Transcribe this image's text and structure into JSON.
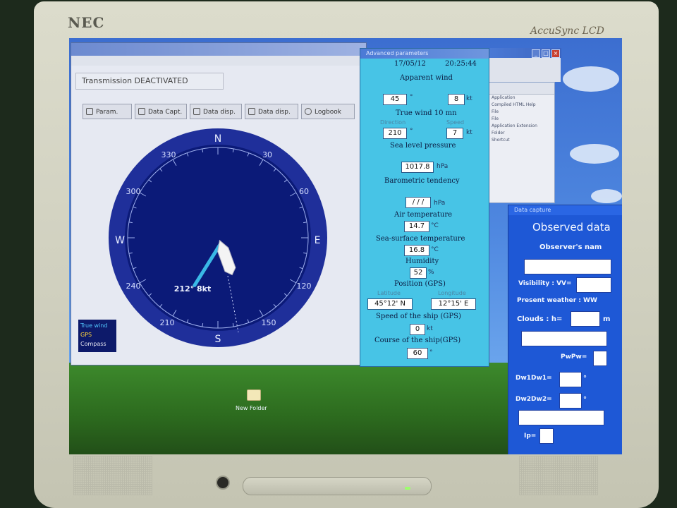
{
  "monitor": {
    "brand": "NEC",
    "model": "AccuSync LCD"
  },
  "app": {
    "title": "",
    "menu": [],
    "status": "Transmission DEACTIVATED",
    "toolbar": [
      {
        "label": "Param.",
        "icon": "param-icon"
      },
      {
        "label": "Data Capt.",
        "icon": "capture-icon"
      },
      {
        "label": "Data disp.",
        "icon": "table-icon"
      },
      {
        "label": "Data disp.",
        "icon": "table-icon"
      },
      {
        "label": "Logbook",
        "icon": "logbook-icon"
      }
    ],
    "compass": {
      "cardinals": {
        "n": "N",
        "e": "E",
        "s": "S",
        "w": "W"
      },
      "degrees": [
        "30",
        "60",
        "120",
        "150",
        "210",
        "240",
        "300",
        "330"
      ],
      "readout": "212° 8kt",
      "wind_direction_deg": 212,
      "ship_heading_deg": 160,
      "colors": {
        "dial": "#0b1a78",
        "ring": "#2a3a9e",
        "wind_needle": "#3ab8e6",
        "ship": "#ffffff"
      }
    },
    "legend": [
      {
        "label": "True wind",
        "color": "#52c8ff"
      },
      {
        "label": "GPS",
        "color": "#ffd23a"
      },
      {
        "label": "Compass",
        "color": "#e6e6f0"
      }
    ]
  },
  "params": {
    "title": "Advanced parameters",
    "date": "17/05/12",
    "time": "20:25:44",
    "apparent_wind": {
      "label": "Apparent wind",
      "direction": "45",
      "direction_unit": "°",
      "speed": "8",
      "speed_unit": "kt"
    },
    "true_wind": {
      "label": "True wind 10 mn",
      "direction_label": "Direction",
      "speed_label": "Speed",
      "direction": "210",
      "direction_unit": "°",
      "speed": "7",
      "speed_unit": "kt"
    },
    "pressure": {
      "label": "Sea level pressure",
      "value": "1017.8",
      "unit": "hPa"
    },
    "tendency": {
      "label": "Barometric tendency",
      "value": "/ / /",
      "unit": "hPa"
    },
    "air_temp": {
      "label": "Air temperature",
      "value": "14.7",
      "unit": "°C"
    },
    "sea_temp": {
      "label": "Sea-surface temperature",
      "value": "16.8",
      "unit": "°C"
    },
    "humidity": {
      "label": "Humidity",
      "value": "52",
      "unit": "%"
    },
    "position": {
      "label": "Position (GPS)",
      "lat_label": "Latitude",
      "lon_label": "Longitude",
      "lat": "45°12' N",
      "lon": "12°15' E"
    },
    "speed": {
      "label": "Speed of the ship (GPS)",
      "value": "0",
      "unit": "kt"
    },
    "course": {
      "label": "Course of the ship(GPS)",
      "value": "60",
      "unit": "°"
    }
  },
  "explorer": {
    "items": [
      "Application",
      "Compiled HTML Help",
      "File",
      "File",
      "Application Extension",
      "Folder",
      "Shortcut"
    ]
  },
  "capture": {
    "title": "Data capture",
    "heading": "Observed data",
    "observer_label": "Observer's nam",
    "visibility_label": "Visibility : VV=",
    "weather_label": "Present weather : WW",
    "clouds_label": "Clouds : h=",
    "clouds_suffix": "m",
    "pwpw_label": "PwPw=",
    "dw1_label": "Dw1Dw1=",
    "dw1_unit": "°",
    "dw2_label": "Dw2Dw2=",
    "dw2_unit": "°",
    "ip_label": "Ip="
  },
  "desktop": {
    "folder_label": "New Folder"
  }
}
